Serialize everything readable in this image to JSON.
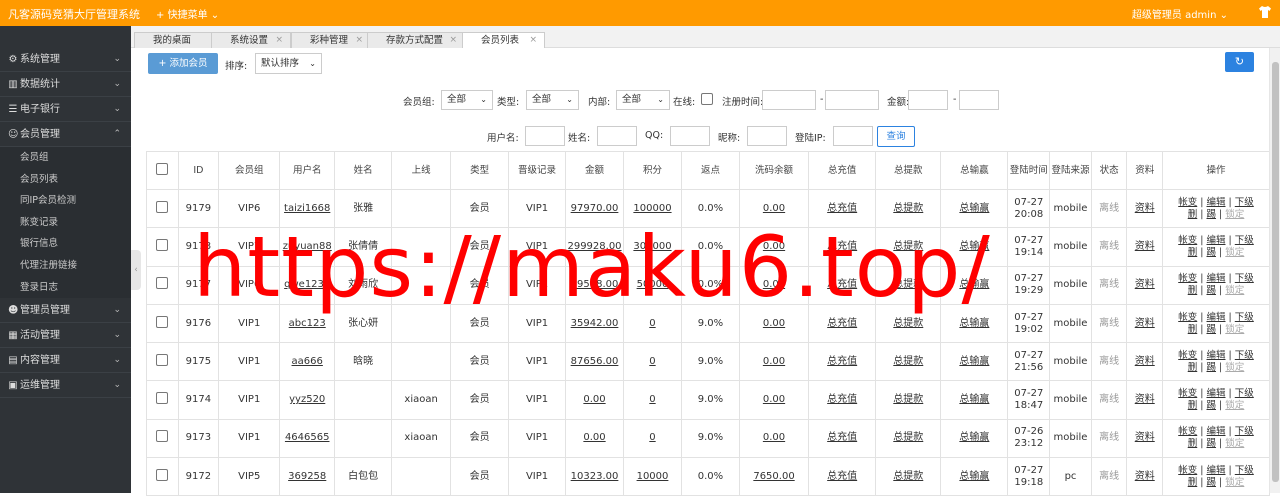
{
  "app": {
    "title": "凡客源码竞猜大厅管理系统",
    "quick_menu": "快捷菜单",
    "user_role": "超级管理员",
    "username": "admin"
  },
  "sidebar": {
    "items": [
      {
        "label": "系统管理",
        "icon": "gear-icon"
      },
      {
        "label": "数据统计",
        "icon": "chart-icon"
      },
      {
        "label": "电子银行",
        "icon": "list-icon"
      },
      {
        "label": "会员管理",
        "icon": "user-icon",
        "expanded": true
      }
    ],
    "subitems": [
      "会员组",
      "会员列表",
      "同IP会员检测",
      "账变记录",
      "银行信息",
      "代理注册链接",
      "登录日志"
    ],
    "items2": [
      {
        "label": "管理员管理",
        "icon": "person-icon"
      },
      {
        "label": "活动管理",
        "icon": "calendar-icon"
      },
      {
        "label": "内容管理",
        "icon": "inbox-icon"
      },
      {
        "label": "运维管理",
        "icon": "server-icon"
      }
    ]
  },
  "tabs": [
    "我的桌面",
    "系统设置",
    "彩种管理",
    "存款方式配置",
    "会员列表"
  ],
  "toolbar": {
    "add_label": "添加会员",
    "sort_label": "排序:",
    "sort_value": "默认排序"
  },
  "filters": {
    "group_label": "会员组:",
    "group_value": "全部",
    "type_label": "类型:",
    "type_value": "全部",
    "internal_label": "内部:",
    "internal_value": "全部",
    "online_label": "在线:",
    "regtime_label": "注册时间:",
    "dash": "-",
    "amount_label": "金额:",
    "username_label": "用户名:",
    "name_label": "姓名:",
    "qq_label": "QQ:",
    "nickname_label": "昵称:",
    "loginip_label": "登陆IP:",
    "query_label": "查询"
  },
  "table": {
    "headers": [
      "ID",
      "会员组",
      "用户名",
      "姓名",
      "上线",
      "类型",
      "晋级记录",
      "金额",
      "积分",
      "返点",
      "洗码余额",
      "总充值",
      "总提款",
      "总输赢",
      "登陆时间",
      "登陆来源",
      "状态",
      "资料",
      "操作"
    ],
    "rows": [
      {
        "id": "9179",
        "group": "VIP6",
        "username": "taizi1668",
        "name": "张雅",
        "upline": "",
        "type": "会员",
        "promo": "VIP1",
        "amount": "97970.00",
        "points": "100000",
        "rebate": "0.0%",
        "wash": "0.00",
        "recharge": "总充值",
        "withdraw": "总提款",
        "winloss": "总输赢",
        "login_time": "07-27 20:08",
        "login_src": "mobile",
        "status": "离线",
        "info": "资料"
      },
      {
        "id": "9178",
        "group": "VIP7",
        "username": "zuyuan88",
        "name": "张倩倩",
        "upline": "",
        "type": "会员",
        "promo": "VIP1",
        "amount": "299928.00",
        "points": "300000",
        "rebate": "0.0%",
        "wash": "0.00",
        "recharge": "总充值",
        "withdraw": "总提款",
        "winloss": "总输赢",
        "login_time": "07-27 19:14",
        "login_src": "mobile",
        "status": "离线",
        "info": "资料"
      },
      {
        "id": "9177",
        "group": "VIP6",
        "username": "qwe1231",
        "name": "刘雨欣",
        "upline": "",
        "type": "会员",
        "promo": "VIP1",
        "amount": "49548.00",
        "points": "50000",
        "rebate": "0.0%",
        "wash": "0.00",
        "recharge": "总充值",
        "withdraw": "总提款",
        "winloss": "总输赢",
        "login_time": "07-27 19:29",
        "login_src": "mobile",
        "status": "离线",
        "info": "资料"
      },
      {
        "id": "9176",
        "group": "VIP1",
        "username": "abc123",
        "name": "张心妍",
        "upline": "",
        "type": "会员",
        "promo": "VIP1",
        "amount": "35942.00",
        "points": "0",
        "rebate": "9.0%",
        "wash": "0.00",
        "recharge": "总充值",
        "withdraw": "总提款",
        "winloss": "总输赢",
        "login_time": "07-27 19:02",
        "login_src": "mobile",
        "status": "离线",
        "info": "资料"
      },
      {
        "id": "9175",
        "group": "VIP1",
        "username": "aa666",
        "name": "晗晓",
        "upline": "",
        "type": "会员",
        "promo": "VIP1",
        "amount": "87656.00",
        "points": "0",
        "rebate": "9.0%",
        "wash": "0.00",
        "recharge": "总充值",
        "withdraw": "总提款",
        "winloss": "总输赢",
        "login_time": "07-27 21:56",
        "login_src": "mobile",
        "status": "离线",
        "info": "资料"
      },
      {
        "id": "9174",
        "group": "VIP1",
        "username": "yyz520",
        "name": "",
        "upline": "xiaoan",
        "type": "会员",
        "promo": "VIP1",
        "amount": "0.00",
        "points": "0",
        "rebate": "9.0%",
        "wash": "0.00",
        "recharge": "总充值",
        "withdraw": "总提款",
        "winloss": "总输赢",
        "login_time": "07-27 18:47",
        "login_src": "mobile",
        "status": "离线",
        "info": "资料"
      },
      {
        "id": "9173",
        "group": "VIP1",
        "username": "4646565",
        "name": "",
        "upline": "xiaoan",
        "type": "会员",
        "promo": "VIP1",
        "amount": "0.00",
        "points": "0",
        "rebate": "9.0%",
        "wash": "0.00",
        "recharge": "总充值",
        "withdraw": "总提款",
        "winloss": "总输赢",
        "login_time": "07-26 23:12",
        "login_src": "mobile",
        "status": "离线",
        "info": "资料"
      },
      {
        "id": "9172",
        "group": "VIP5",
        "username": "369258",
        "name": "白包包",
        "upline": "",
        "type": "会员",
        "promo": "VIP1",
        "amount": "10323.00",
        "points": "10000",
        "rebate": "0.0%",
        "wash": "7650.00",
        "recharge": "总充值",
        "withdraw": "总提款",
        "winloss": "总输赢",
        "login_time": "07-27 19:18",
        "login_src": "pc",
        "status": "离线",
        "info": "资料"
      }
    ],
    "ops": {
      "account": "帐变",
      "edit": "编辑",
      "subordinate": "下级",
      "delete": "删",
      "kick": "踢",
      "lock": "锁定",
      "sep": "|"
    }
  },
  "watermark": "https://maku6.top/",
  "colors": {
    "topbar": "#ff9a00",
    "sidebar": "#2f3337",
    "primary": "#2c82e0",
    "add_button": "#5a9bd5",
    "watermark": "#ff0000"
  }
}
